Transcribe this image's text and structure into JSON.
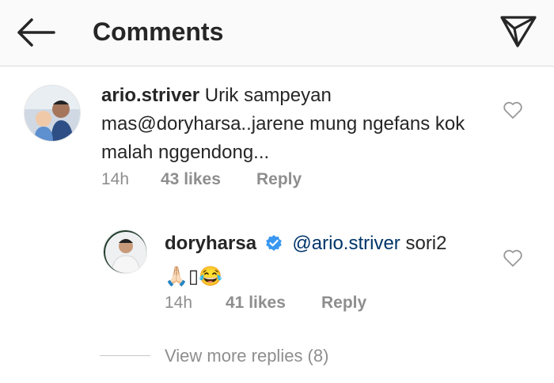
{
  "header": {
    "title": "Comments",
    "back_icon": "arrow-left-icon",
    "direct_icon": "paper-plane-icon"
  },
  "comments": [
    {
      "username": "ario.striver",
      "text": "Urik sampeyan mas@doryharsa..jarene mung ngefans kok malah nggendong...",
      "time": "14h",
      "likes": "43 likes",
      "reply": "Reply"
    },
    {
      "username": "doryharsa",
      "verified": true,
      "mention": "@ario.striver",
      "text": "sori2",
      "emojis": "🙏🏻▯😂",
      "time": "14h",
      "likes": "41 likes",
      "reply": "Reply"
    }
  ],
  "view_more": "View more replies (8)",
  "colors": {
    "mention": "#003569",
    "verified": "#3897f0",
    "muted": "#8e8e8e"
  }
}
